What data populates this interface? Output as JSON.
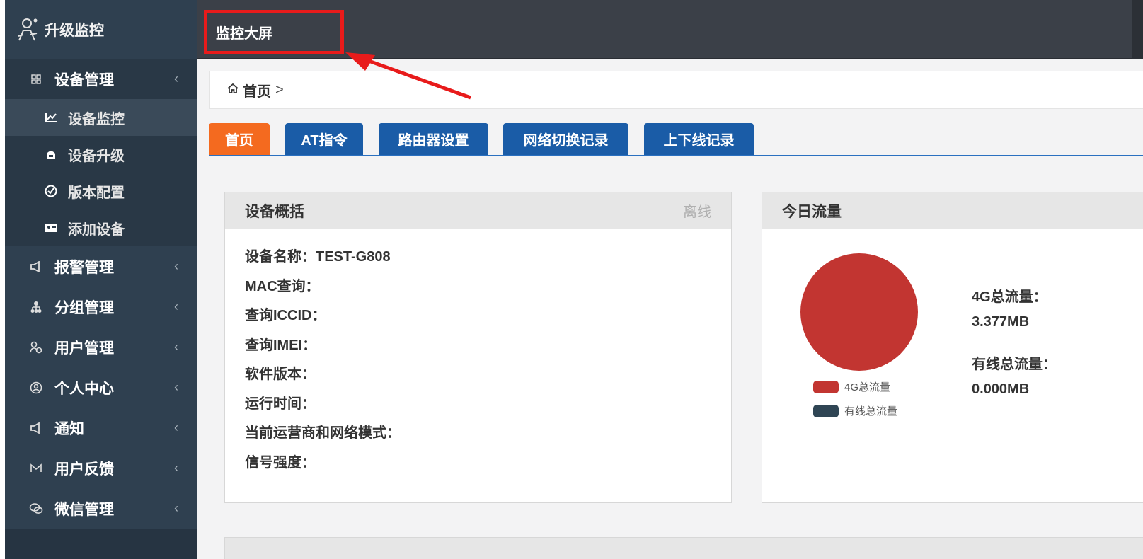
{
  "sidebar": {
    "brand": "升级监控",
    "menus": [
      {
        "label": "设备管理",
        "icon": "grid-icon",
        "open": true,
        "children": [
          {
            "label": "设备监控",
            "icon": "line-chart-icon",
            "current": true
          },
          {
            "label": "设备升级",
            "icon": "upgrade-icon"
          },
          {
            "label": "版本配置",
            "icon": "check-circle-icon"
          },
          {
            "label": "添加设备",
            "icon": "add-device-icon"
          }
        ]
      },
      {
        "label": "报警管理",
        "icon": "megaphone-icon"
      },
      {
        "label": "分组管理",
        "icon": "sitemap-icon"
      },
      {
        "label": "用户管理",
        "icon": "user-group-icon"
      },
      {
        "label": "个人中心",
        "icon": "user-circle-icon"
      },
      {
        "label": "通知",
        "icon": "megaphone-icon"
      },
      {
        "label": "用户反馈",
        "icon": "mail-icon"
      },
      {
        "label": "微信管理",
        "icon": "wechat-icon"
      }
    ]
  },
  "topbar": {
    "nav_title": "监控大屏"
  },
  "breadcrumb": {
    "home": "首页",
    "sep": ">"
  },
  "tabs": [
    "首页",
    "AT指令",
    "路由器设置",
    "网络切换记录",
    "上下线记录"
  ],
  "overview": {
    "title": "设备概括",
    "status": "离线",
    "rows": [
      "设备名称：TEST-G808",
      "MAC查询：",
      "查询ICCID：",
      "查询IMEI：",
      "软件版本：",
      "运行时间：",
      "当前运营商和网络模式：",
      "信号强度："
    ]
  },
  "traffic": {
    "title": "今日流量",
    "legend": [
      {
        "label": "4G总流量",
        "color": "#c23531"
      },
      {
        "label": "有线总流量",
        "color": "#2f4554"
      }
    ],
    "stats": [
      {
        "label": "4G总流量：",
        "value": "3.377MB"
      },
      {
        "label": "有线总流量：",
        "value": "0.000MB"
      }
    ]
  },
  "colors": {
    "accent_tab": "#f46a1f",
    "tab": "#1a5ca7",
    "sidebar": "#2f4050",
    "annotation": "#e81b1b"
  }
}
